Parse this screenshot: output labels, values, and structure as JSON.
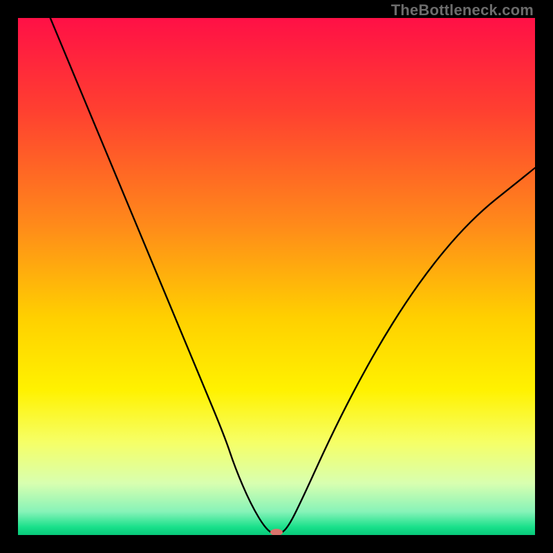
{
  "watermark": "TheBottleneck.com",
  "chart_data": {
    "type": "line",
    "title": "",
    "xlabel": "",
    "ylabel": "",
    "xlim": [
      0,
      100
    ],
    "ylim": [
      0,
      100
    ],
    "curve": {
      "name": "bottleneck-curve",
      "x": [
        0,
        5,
        10,
        15,
        20,
        25,
        30,
        35,
        40,
        42,
        45,
        48,
        50,
        52,
        55,
        60,
        65,
        70,
        75,
        80,
        85,
        90,
        95,
        100
      ],
      "values": [
        115,
        103,
        91,
        79,
        67,
        55,
        43,
        31,
        19,
        13,
        6,
        1,
        0,
        1,
        7,
        18,
        28,
        37,
        45,
        52,
        58,
        63,
        67,
        71
      ]
    },
    "marker": {
      "x": 50,
      "y": 0,
      "color": "#d9736c",
      "rx": 9,
      "ry": 5
    },
    "gradient_stops": [
      {
        "offset": 0.0,
        "color": "#ff1046"
      },
      {
        "offset": 0.18,
        "color": "#ff4030"
      },
      {
        "offset": 0.4,
        "color": "#ff8a1a"
      },
      {
        "offset": 0.58,
        "color": "#ffd000"
      },
      {
        "offset": 0.72,
        "color": "#fff200"
      },
      {
        "offset": 0.82,
        "color": "#f6ff66"
      },
      {
        "offset": 0.9,
        "color": "#d8ffb0"
      },
      {
        "offset": 0.955,
        "color": "#86f3b8"
      },
      {
        "offset": 0.985,
        "color": "#18e08a"
      },
      {
        "offset": 1.0,
        "color": "#08c97a"
      }
    ]
  }
}
